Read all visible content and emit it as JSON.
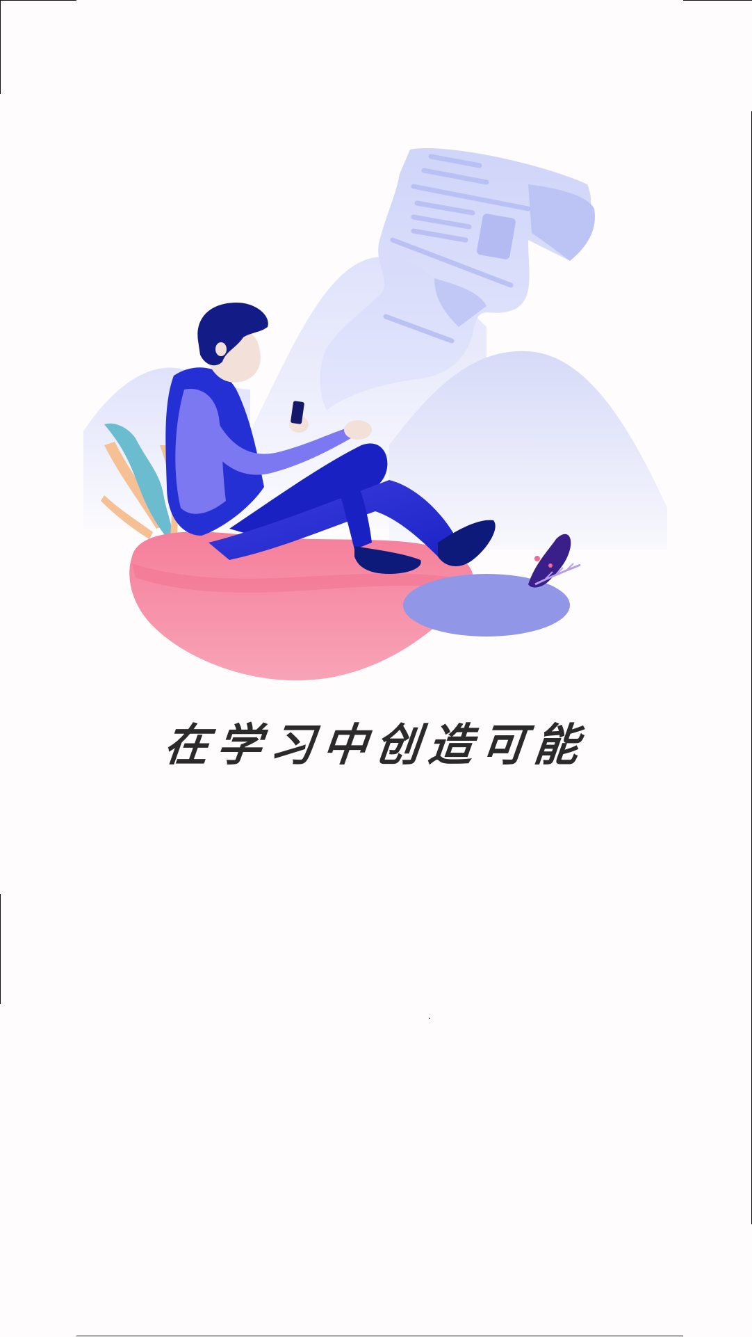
{
  "splash": {
    "slogan": "在学习中创造可能"
  },
  "illustration": {
    "subject": "person-reading-phone-illustration"
  },
  "colors": {
    "background": "#fefcfc",
    "accent_blue": "#1a2bd0",
    "accent_pink": "#f58ba6",
    "lavender": "#c7cdf7"
  }
}
